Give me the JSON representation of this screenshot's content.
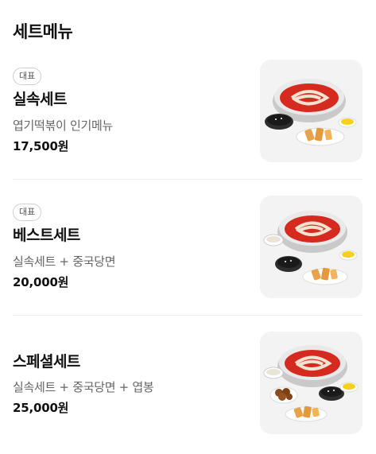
{
  "section_title": "세트메뉴",
  "items": [
    {
      "badge": "대표",
      "name": "실속세트",
      "description": "엽기떡볶이 인기메뉴",
      "price": "17,500원",
      "image": "tteokbokki-set-photo"
    },
    {
      "badge": "대표",
      "name": "베스트세트",
      "description": "실속세트 + 중국당면",
      "price": "20,000원",
      "image": "tteokbokki-set-photo"
    },
    {
      "name": "스페셜세트",
      "description": "실속세트 + 중국당면 + 엽봉",
      "price": "25,000원",
      "image": "tteokbokki-set-photo"
    }
  ]
}
